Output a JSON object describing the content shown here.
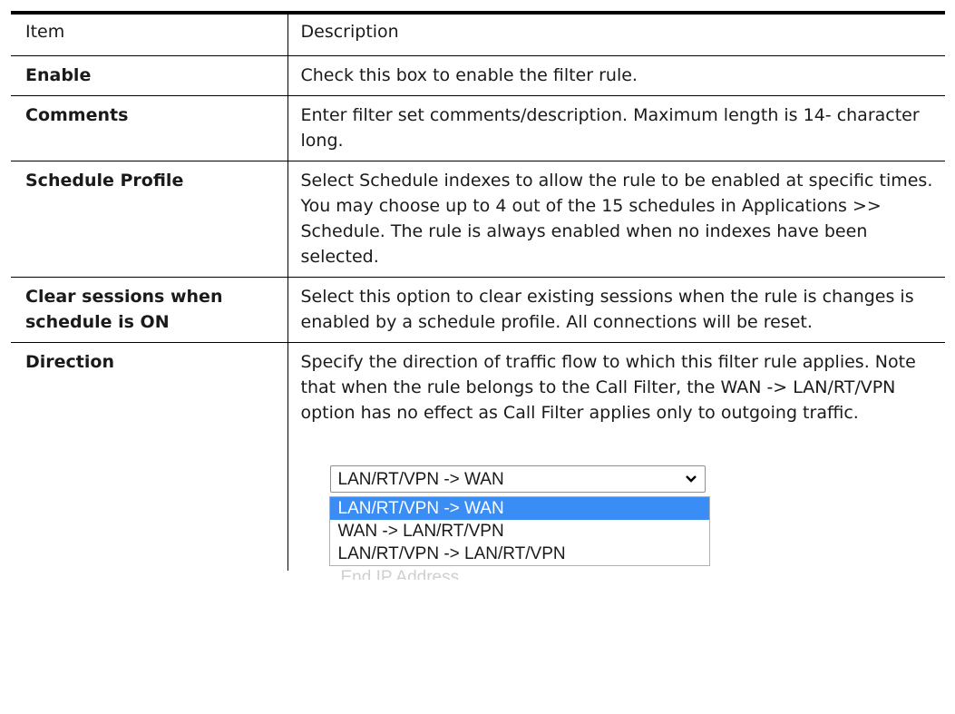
{
  "table": {
    "header": {
      "item": "Item",
      "description": "Description"
    },
    "rows": [
      {
        "item": "Enable",
        "description": "Check this box to enable the filter rule."
      },
      {
        "item": "Comments",
        "description": "Enter filter set comments/description. Maximum length is 14- character long."
      },
      {
        "item": "Schedule Profile",
        "description": "Select Schedule indexes to allow the rule to be enabled at specific times. You may choose up to 4 out of the 15 schedules in Applications >> Schedule. The rule is always enabled when no indexes have been selected."
      },
      {
        "item": "Clear sessions when schedule is ON",
        "description": "Select this option to clear existing sessions when the rule is changes is enabled by a schedule profile. All connections will be reset."
      },
      {
        "item": "Direction",
        "description": "Specify the direction of traffic flow to which this filter rule applies. Note that when the rule belongs to the Call Filter, the WAN -> LAN/RT/VPN option has no effect as Call Filter applies only to outgoing traffic."
      }
    ]
  },
  "direction_select": {
    "selected_value": "LAN/RT/VPN -> WAN",
    "options": [
      "LAN/RT/VPN -> WAN",
      "WAN -> LAN/RT/VPN",
      "LAN/RT/VPN -> LAN/RT/VPN"
    ],
    "highlight_color": "#3a8df5"
  },
  "partial_label": "End IP Address"
}
